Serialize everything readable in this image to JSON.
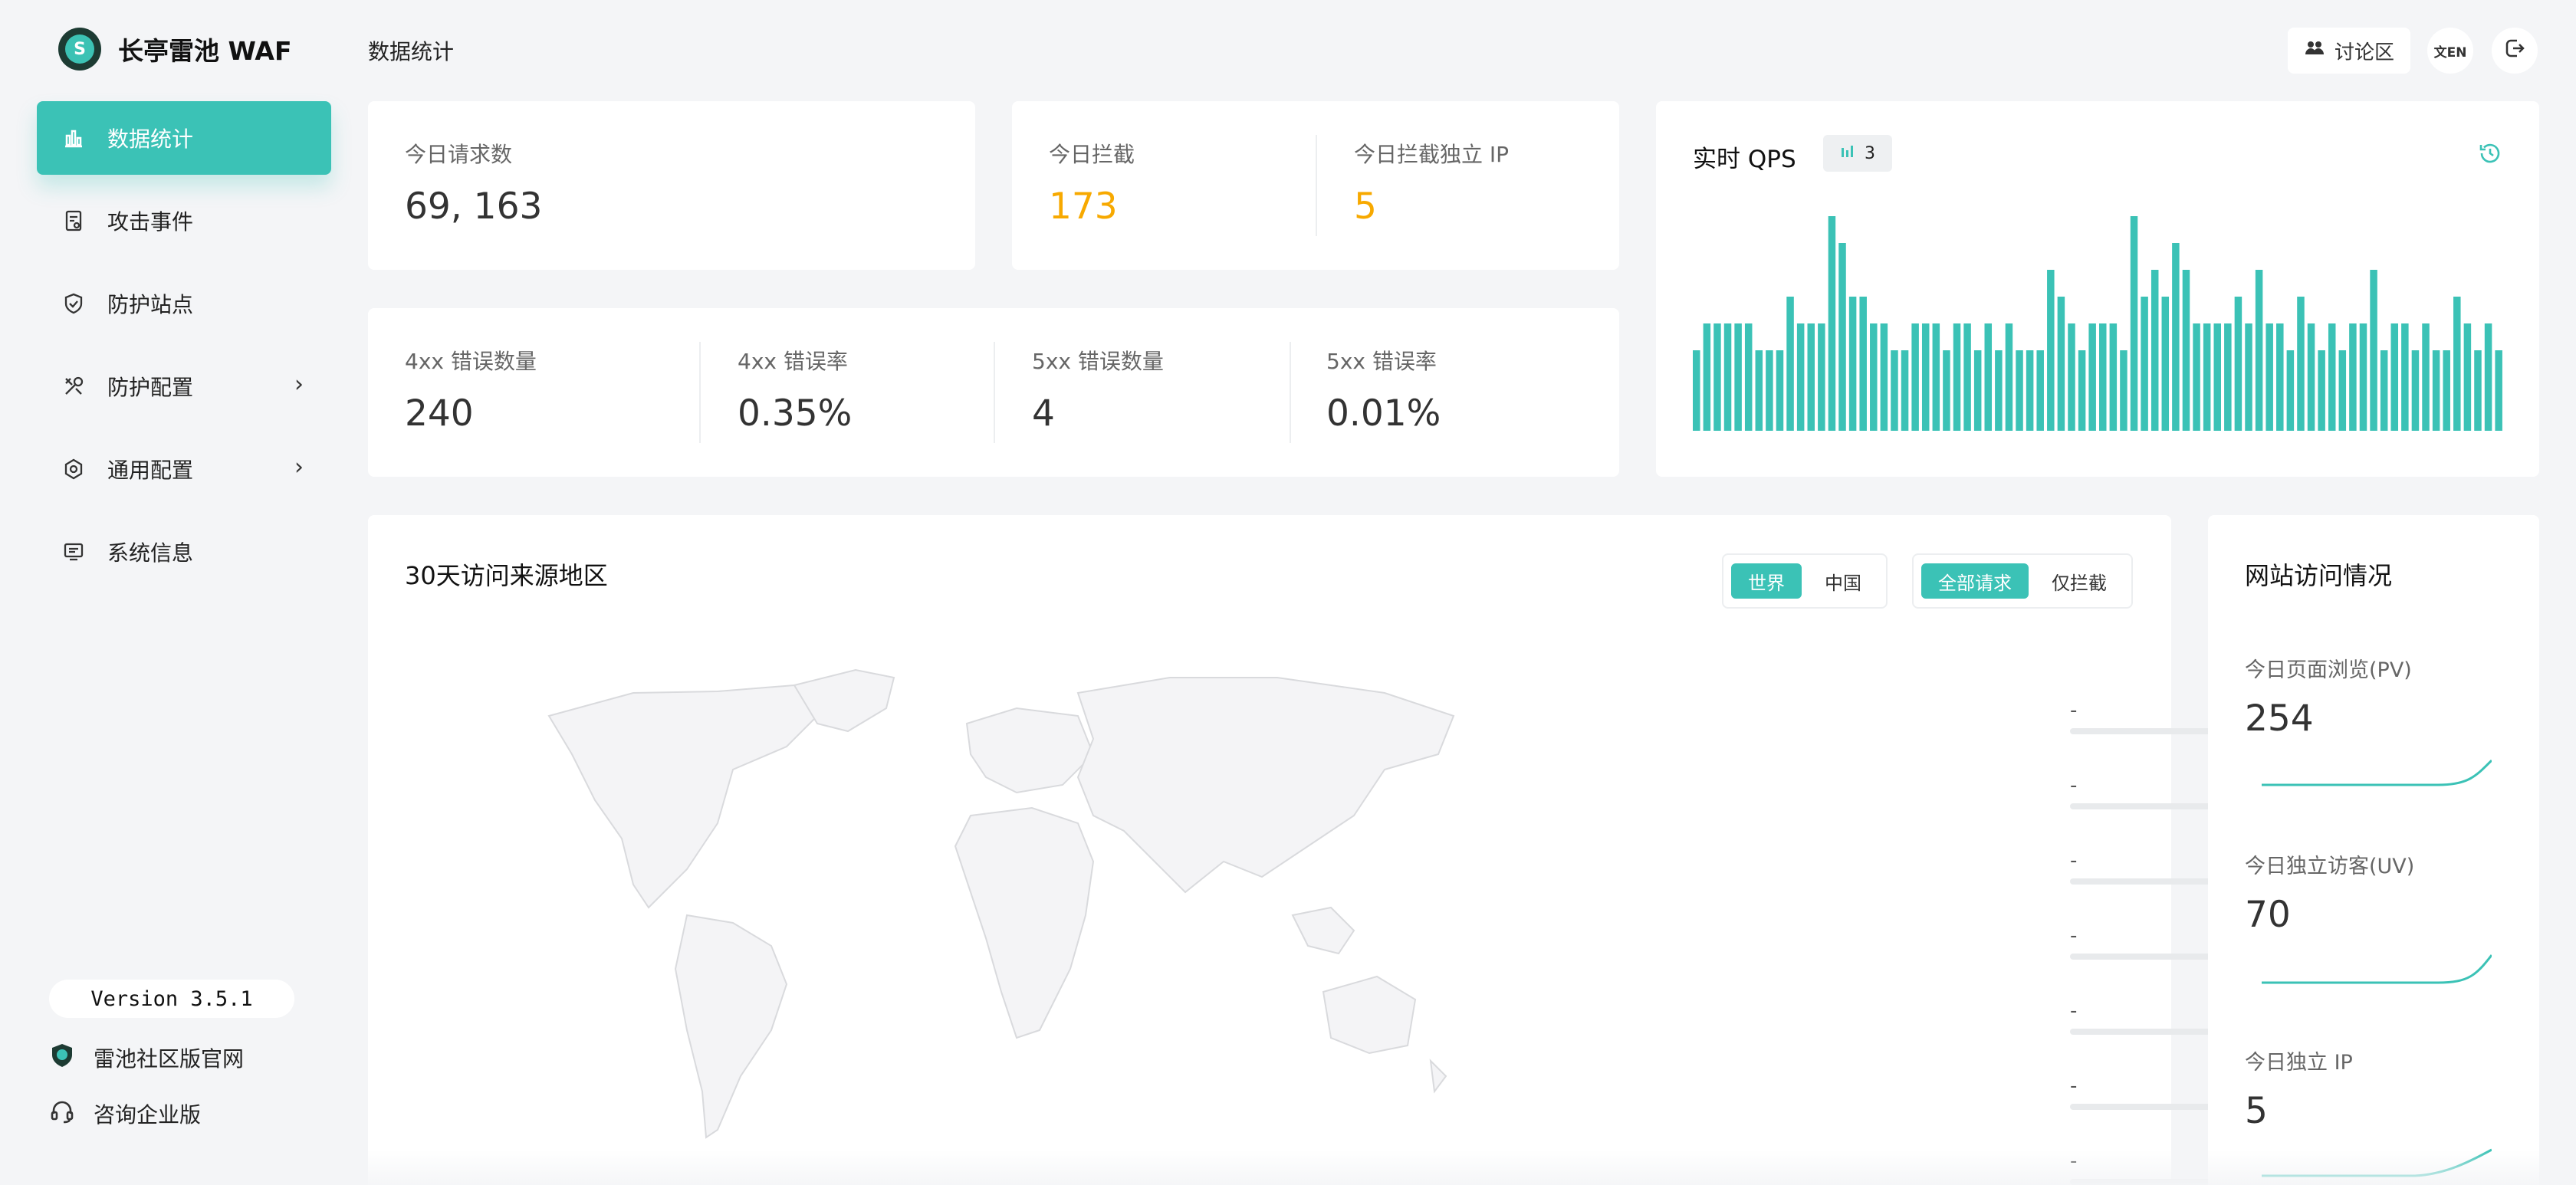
{
  "app": {
    "title": "长亭雷池 WAF"
  },
  "sidebar": {
    "items": [
      {
        "label": "数据统计",
        "icon": "bar-chart-icon",
        "active": true
      },
      {
        "label": "攻击事件",
        "icon": "event-doc-icon"
      },
      {
        "label": "防护站点",
        "icon": "shield-icon"
      },
      {
        "label": "防护配置",
        "icon": "tools-icon",
        "has_submenu": true
      },
      {
        "label": "通用配置",
        "icon": "gear-icon",
        "has_submenu": true
      },
      {
        "label": "系统信息",
        "icon": "monitor-icon"
      }
    ],
    "version": "Version 3.5.1",
    "links": [
      {
        "label": "雷池社区版官网",
        "icon": "shield-logo-icon"
      },
      {
        "label": "咨询企业版",
        "icon": "headset-icon"
      }
    ]
  },
  "header": {
    "page_title": "数据统计",
    "forum_label": "讨论区",
    "lang_label": "文EN"
  },
  "stats": {
    "requests": {
      "label": "今日请求数",
      "value": "69, 163"
    },
    "blocked": {
      "label": "今日拦截",
      "value": "173"
    },
    "blocked_ip": {
      "label": "今日拦截独立 IP",
      "value": "5"
    },
    "errors": [
      {
        "label": "4xx 错误数量",
        "value": "240"
      },
      {
        "label": "4xx 错误率",
        "value": "0.35%"
      },
      {
        "label": "5xx 错误数量",
        "value": "4"
      },
      {
        "label": "5xx 错误率",
        "value": "0.01%"
      }
    ]
  },
  "qps": {
    "title": "实时 QPS",
    "badge": "3",
    "bar_color": "#3bc2b6",
    "chart_data": {
      "type": "bar",
      "values": [
        3,
        4,
        4,
        4,
        4,
        4,
        3,
        3,
        3,
        5,
        4,
        4,
        4,
        8,
        7,
        5,
        5,
        4,
        4,
        3,
        3,
        4,
        4,
        4,
        3,
        4,
        4,
        3,
        4,
        3,
        4,
        3,
        3,
        3,
        6,
        5,
        4,
        3,
        4,
        4,
        4,
        3,
        8,
        5,
        6,
        5,
        7,
        6,
        4,
        4,
        4,
        4,
        5,
        4,
        6,
        4,
        4,
        3,
        5,
        4,
        3,
        4,
        3,
        4,
        4,
        6,
        3,
        4,
        4,
        3,
        4,
        3,
        3,
        5,
        4,
        3,
        4,
        3
      ],
      "ylim": [
        0,
        8
      ]
    }
  },
  "map": {
    "title": "30天访问来源地区",
    "scope_options": [
      "世界",
      "中国"
    ],
    "scope_selected": "世界",
    "filter_options": [
      "全部请求",
      "仅拦截"
    ],
    "filter_selected": "全部请求",
    "regions": [
      {
        "name": "-",
        "count": "0"
      },
      {
        "name": "-",
        "count": "0"
      },
      {
        "name": "-",
        "count": "0"
      },
      {
        "name": "-",
        "count": "0"
      },
      {
        "name": "-",
        "count": "0"
      },
      {
        "name": "-",
        "count": "0"
      },
      {
        "name": "-",
        "count": "0"
      }
    ]
  },
  "site_visits": {
    "title": "网站访问情况",
    "pv": {
      "label": "今日页面浏览(PV)",
      "value": "254"
    },
    "uv": {
      "label": "今日独立访客(UV)",
      "value": "70"
    },
    "ip": {
      "label": "今日独立 IP",
      "value": "5"
    }
  },
  "colors": {
    "accent": "#3bc2b6",
    "warning": "#f7a900"
  }
}
